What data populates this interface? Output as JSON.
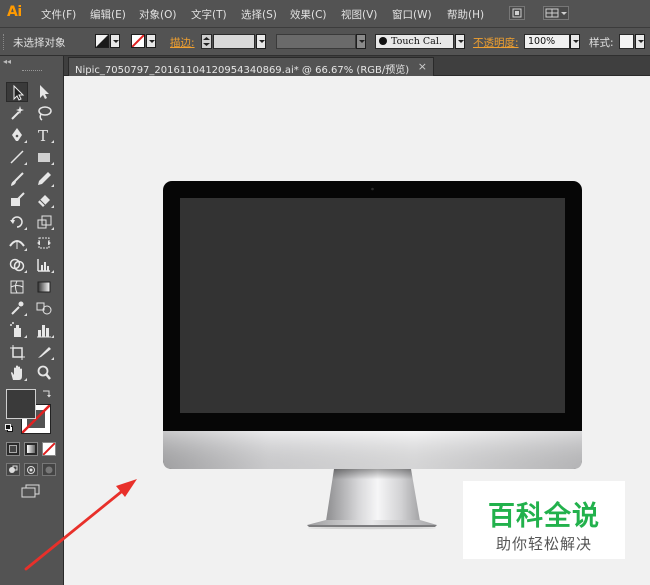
{
  "app": {
    "logo": "Ai"
  },
  "menu": {
    "items": [
      "文件(F)",
      "编辑(E)",
      "对象(O)",
      "文字(T)",
      "选择(S)",
      "效果(C)",
      "视图(V)",
      "窗口(W)",
      "帮助(H)"
    ]
  },
  "control_bar": {
    "selection_status": "未选择对象",
    "stroke_label": "描边:",
    "brush_name": "Touch Cal.",
    "opacity_label": "不透明度:",
    "opacity_value": "100%",
    "style_label": "样式:"
  },
  "document": {
    "tab_title": "Nipic_7050797_20161104120954340869.ai* @ 66.67% (RGB/预览)",
    "close_glyph": "×"
  },
  "tools": [
    "selection-tool",
    "direct-selection-tool",
    "magic-wand-tool",
    "lasso-tool",
    "pen-tool",
    "type-tool",
    "line-segment-tool",
    "rectangle-tool",
    "paintbrush-tool",
    "pencil-tool",
    "blob-brush-tool",
    "eraser-tool",
    "rotate-tool",
    "scale-tool",
    "width-tool",
    "free-transform-tool",
    "shape-builder-tool",
    "perspective-grid-tool",
    "mesh-tool",
    "gradient-tool",
    "eyedropper-tool",
    "blend-tool",
    "symbol-sprayer-tool",
    "column-graph-tool",
    "artboard-tool",
    "slice-tool",
    "hand-tool",
    "zoom-tool"
  ],
  "colors": {
    "fill": "#3a3a3a",
    "stroke": "none",
    "ui_background": "#535353",
    "canvas": "#f1f1f1",
    "accent_orange": "#f0a030",
    "watermark_green": "#22b14c",
    "arrow_red": "#e8302a"
  },
  "watermark": {
    "main": "百科全说",
    "sub": "助你轻松解决"
  }
}
